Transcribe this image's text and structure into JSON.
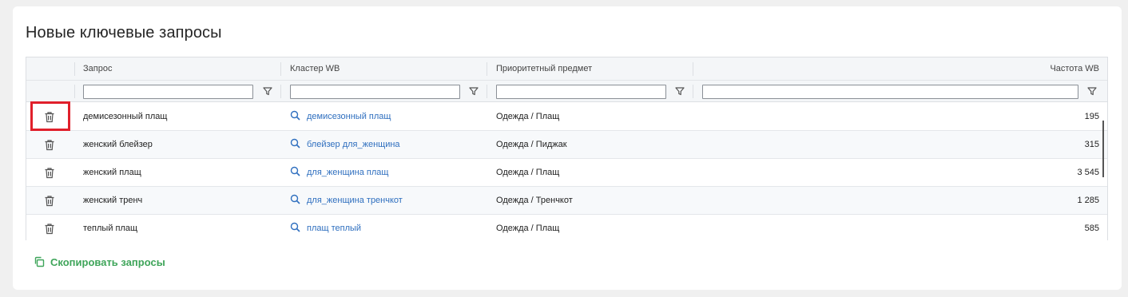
{
  "card": {
    "title": "Новые ключевые запросы"
  },
  "table": {
    "columns": [
      "Запрос",
      "Кластер WB",
      "Приоритетный предмет",
      "Частота WB"
    ],
    "rows": [
      {
        "query": "демисезонный плащ",
        "cluster": "демисезонный плащ",
        "subject": "Одежда / Плащ",
        "frequency": "195"
      },
      {
        "query": "женский блейзер",
        "cluster": "блейзер для_женщина",
        "subject": "Одежда / Пиджак",
        "frequency": "315"
      },
      {
        "query": "женский плащ",
        "cluster": "для_женщина плащ",
        "subject": "Одежда / Плащ",
        "frequency": "3 545"
      },
      {
        "query": "женский тренч",
        "cluster": "для_женщина тренчкот",
        "subject": "Одежда / Тренчкот",
        "frequency": "1 285"
      },
      {
        "query": "теплый плащ",
        "cluster": "плащ теплый",
        "subject": "Одежда / Плащ",
        "frequency": "585"
      }
    ]
  },
  "copy_button": {
    "label": "Скопировать запросы"
  },
  "colors": {
    "link": "#2f6fbf",
    "accent_green": "#3fa55a",
    "highlight": "#e0202b"
  },
  "icons": [
    "trash-icon",
    "search-icon",
    "filter-icon",
    "copy-icon"
  ]
}
